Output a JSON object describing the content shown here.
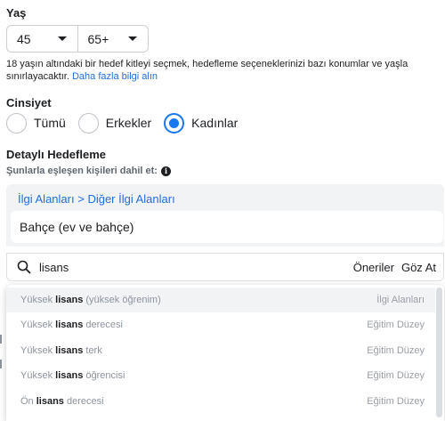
{
  "age": {
    "label": "Yaş",
    "min": "45",
    "max": "65+",
    "note": "18 yaşın altındaki bir hedef kitleyi seçmek, hedefleme seçeneklerinizi bazı konumlar ve yaşla sınırlayacaktır.",
    "note_link": "Daha fazla bilgi alın"
  },
  "gender": {
    "label": "Cinsiyet",
    "options": [
      "Tümü",
      "Erkekler",
      "Kadınlar"
    ],
    "selected": "Kadınlar"
  },
  "detailed": {
    "label": "Detaylı Hedefleme",
    "sub": "Şunlarla eşleşen kişileri dahil et:",
    "breadcrumb_1": "İlgi Alanları",
    "breadcrumb_sep": ">",
    "breadcrumb_2": "Diğer İlgi Alanları",
    "selected_chip": "Bahçe (ev ve bahçe)"
  },
  "search": {
    "value": "lisans",
    "suggestions_label": "Öneriler",
    "browse_label": "Göz At"
  },
  "dropdown": {
    "items": [
      {
        "pre": "Yüksek ",
        "bold": "lisans",
        "post": " (yüksek öğrenim)",
        "category": "İlgi Alanları"
      },
      {
        "pre": "Yüksek ",
        "bold": "lisans",
        "post": " derecesi",
        "category": "Eğitim Düzey"
      },
      {
        "pre": "Yüksek ",
        "bold": "lisans",
        "post": " terk",
        "category": "Eğitim Düzey"
      },
      {
        "pre": "Yüksek ",
        "bold": "lisans",
        "post": " öğrencisi",
        "category": "Eğitim Düzey"
      },
      {
        "pre": "Ön ",
        "bold": "lisans",
        "post": " derecesi",
        "category": "Eğitim Düzey"
      }
    ]
  },
  "colors": {
    "accent": "#1877f2",
    "link": "#216fdb",
    "muted": "#8d949e"
  }
}
